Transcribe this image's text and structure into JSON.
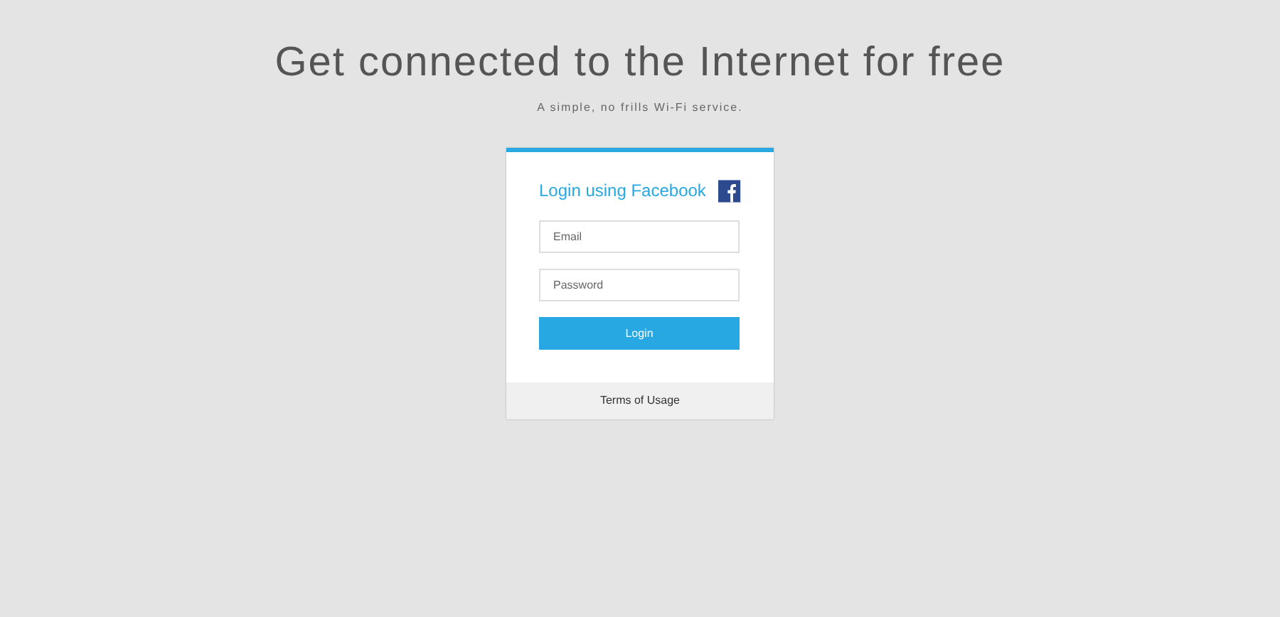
{
  "header": {
    "title": "Get connected to the Internet for free",
    "subtitle": "A simple, no frills Wi-Fi service."
  },
  "login": {
    "facebook_label": "Login using Facebook",
    "email": {
      "placeholder": "Email"
    },
    "password": {
      "placeholder": "Password"
    },
    "button": "Login"
  },
  "footer": {
    "link": "Terms of Usage"
  }
}
